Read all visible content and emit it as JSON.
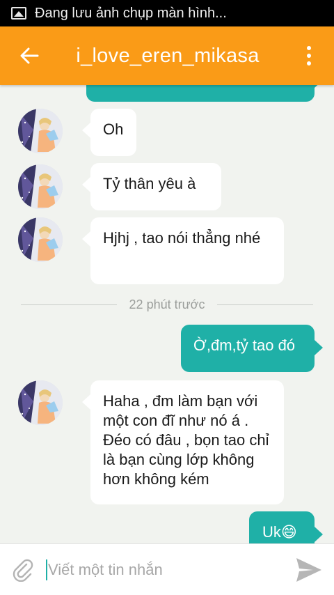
{
  "status_bar": {
    "notification_text": "Đang lưu ảnh chụp màn hình...",
    "icon": "image-icon"
  },
  "header": {
    "title": "i_love_eren_mikasa",
    "back_icon": "arrow-back-icon",
    "menu_icon": "more-vert-icon",
    "color": "#fa9b17"
  },
  "messages": [
    {
      "direction": "incoming",
      "text": "Oh"
    },
    {
      "direction": "incoming",
      "text": "Tỷ thân yêu à"
    },
    {
      "direction": "incoming",
      "text": "Hjhj , tao nói thẳng nhé"
    },
    {
      "direction": "outgoing",
      "text": "Ờ,đm,tỷ tao đó"
    },
    {
      "direction": "incoming",
      "text": "Haha , đm làm bạn với một con đĩ như nó á . Đéo có đâu , bọn tao chỉ là bạn cùng lớp không hơn không kém"
    },
    {
      "direction": "outgoing",
      "text": "Uk😄"
    }
  ],
  "divider": {
    "text": "22 phút trước"
  },
  "composer": {
    "placeholder": "Viết một tin nhắn",
    "value": "",
    "attach_icon": "paperclip-icon",
    "send_icon": "send-icon"
  },
  "colors": {
    "outgoing_bubble": "#1fb0a7",
    "incoming_bubble": "#ffffff",
    "background": "#f1f3ef"
  }
}
